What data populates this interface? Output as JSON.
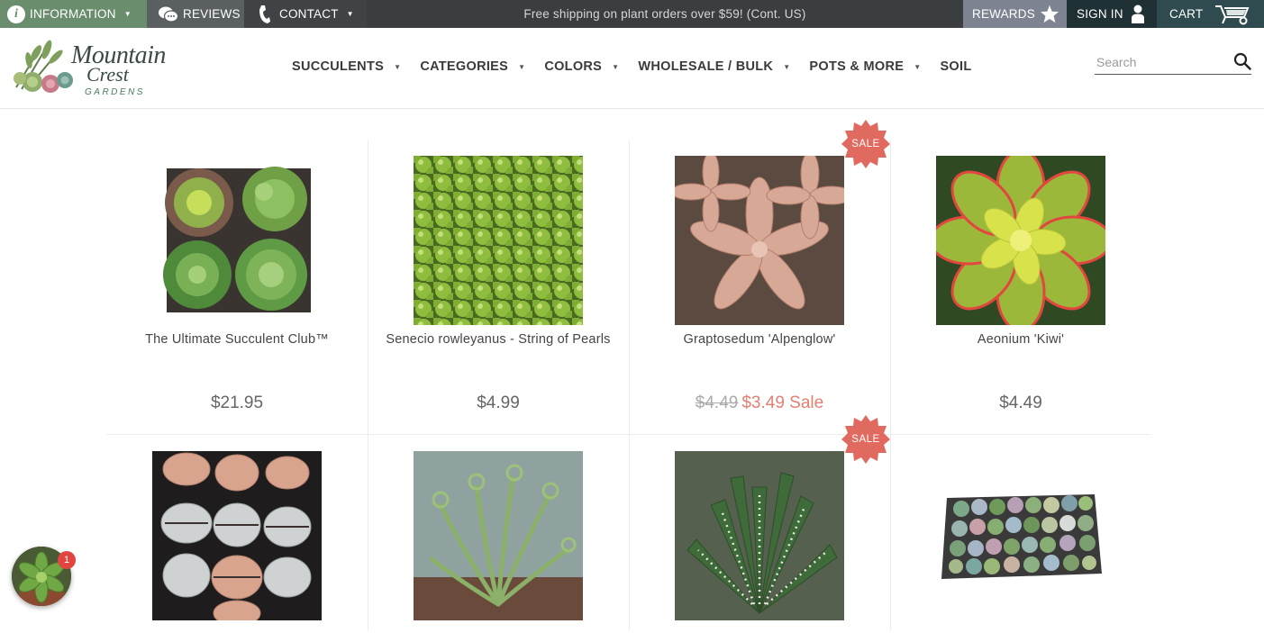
{
  "topbar": {
    "information": "INFORMATION",
    "reviews": "REVIEWS",
    "contact": "CONTACT",
    "shipping_notice": "Free shipping on plant orders over $59! (Cont. US)",
    "rewards": "REWARDS",
    "sign_in": "SIGN IN",
    "cart": "CART",
    "icons": [
      "info-icon",
      "chat-icon",
      "phone-icon",
      "star-icon",
      "user-icon",
      "wheelbarrow-icon"
    ]
  },
  "header": {
    "logo": {
      "line1": "Mountain",
      "line2": "Crest",
      "line3": "GARDENS"
    },
    "nav": [
      {
        "label": "SUCCULENTS",
        "has_dropdown": true
      },
      {
        "label": "CATEGORIES",
        "has_dropdown": true
      },
      {
        "label": "COLORS",
        "has_dropdown": true
      },
      {
        "label": "WHOLESALE / BULK",
        "has_dropdown": true
      },
      {
        "label": "POTS & MORE",
        "has_dropdown": true
      },
      {
        "label": "SOIL",
        "has_dropdown": false
      }
    ],
    "search": {
      "placeholder": "Search",
      "value": ""
    }
  },
  "products": [
    {
      "name": "The Ultimate Succulent Club™",
      "price": "$21.95",
      "image": "succulent-club-image"
    },
    {
      "name": "Senecio rowleyanus - String of Pearls",
      "price": "$4.99",
      "image": "string-of-pearls-image"
    },
    {
      "name": "Graptosedum 'Alpenglow'",
      "old_price": "$4.49",
      "sale_price": "$3.49 Sale",
      "badge": "SALE",
      "image": "alpenglow-image"
    },
    {
      "name": "Aeonium 'Kiwi'",
      "price": "$4.49",
      "image": "aeonium-kiwi-image"
    },
    {
      "name": "",
      "image": "lithops-image"
    },
    {
      "name": "",
      "image": "albuca-spiralis-image"
    },
    {
      "name": "",
      "badge": "SALE",
      "image": "haworthia-image"
    },
    {
      "name": "",
      "image": "succulent-tray-image"
    }
  ],
  "chat": {
    "unread_count": "1"
  },
  "colors": {
    "topbar": "#3a3e40",
    "info": "#6a8e6d",
    "sale": "#e37f72",
    "badge": "#e06a5f"
  }
}
